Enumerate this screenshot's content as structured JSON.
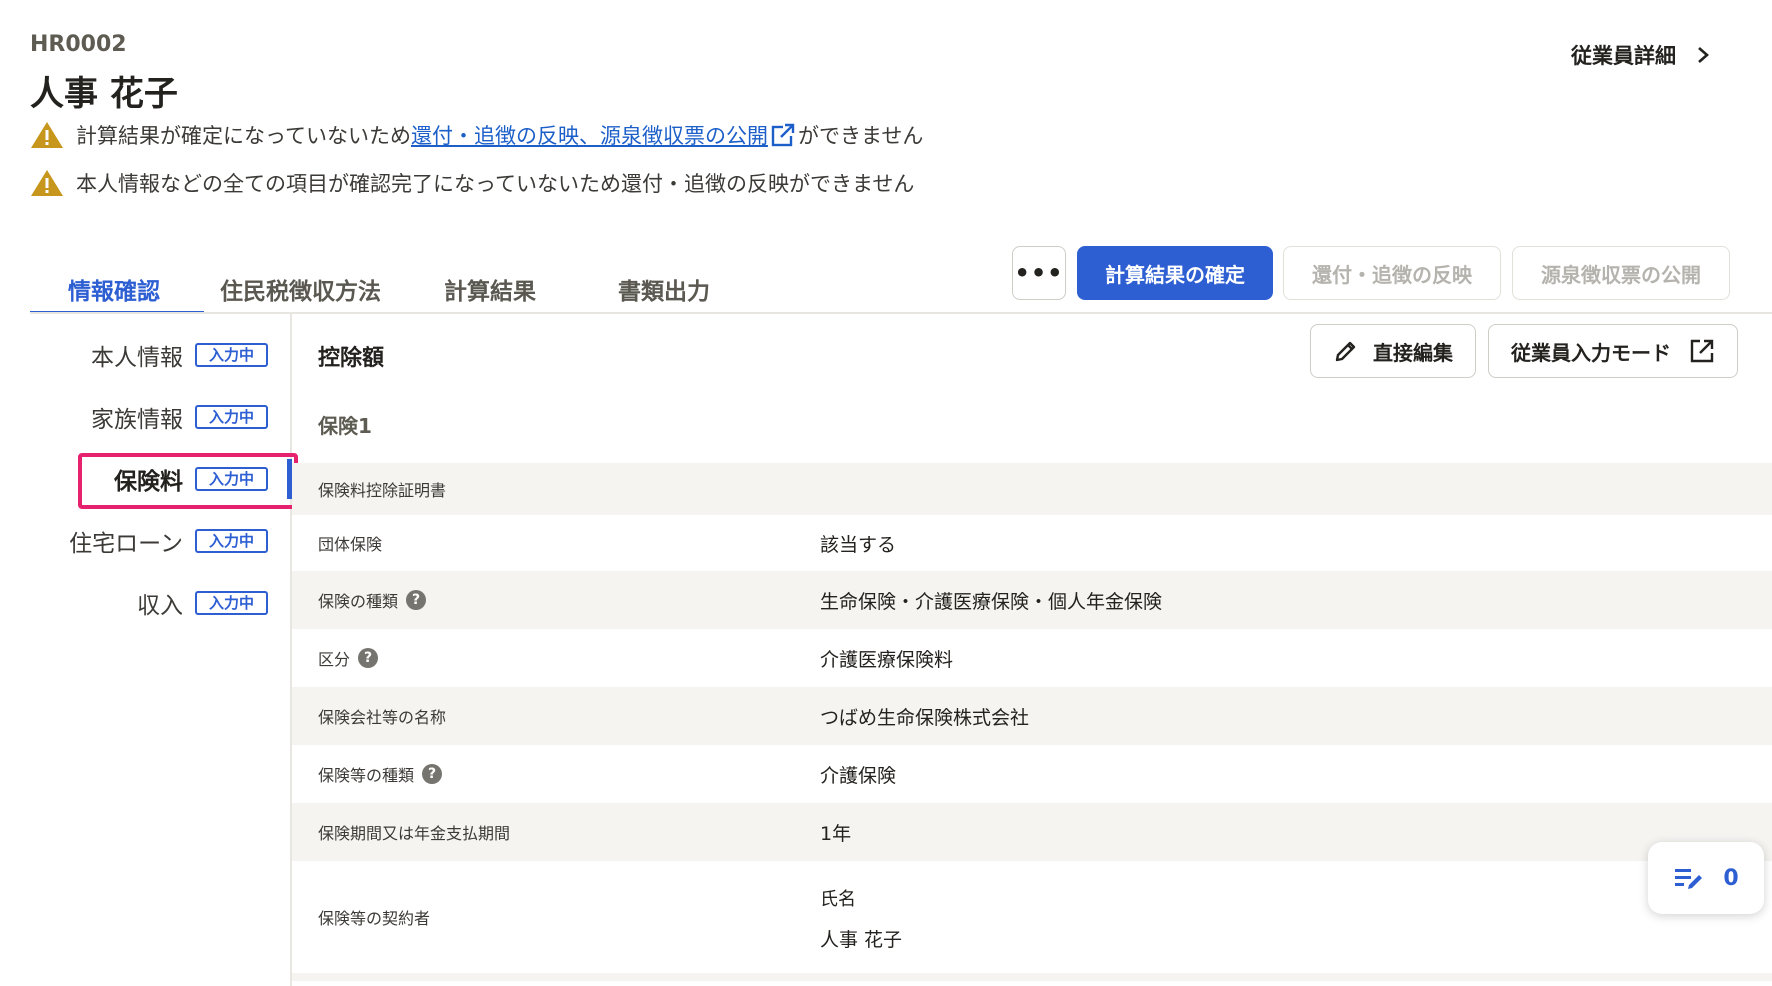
{
  "employee": {
    "id": "HR0002",
    "name": "人事 花子",
    "detail_link": "従業員詳細"
  },
  "warnings": [
    {
      "prefix": "計算結果が確定になっていないため",
      "link": "還付・追徴の反映、源泉徴収票の公開",
      "suffix": "ができません"
    },
    {
      "text": "本人情報などの全ての項目が確認完了になっていないため還付・追徴の反映ができません"
    }
  ],
  "tabs": [
    {
      "label": "情報確認",
      "active": true
    },
    {
      "label": "住民税徴収方法"
    },
    {
      "label": "計算結果"
    },
    {
      "label": "書類出力"
    }
  ],
  "actions": {
    "more": "•••",
    "confirm": "計算結果の確定",
    "refund": "還付・追徴の反映",
    "publish": "源泉徴収票の公開"
  },
  "sidebar": [
    {
      "label": "本人情報",
      "badge": "入力中"
    },
    {
      "label": "家族情報",
      "badge": "入力中"
    },
    {
      "label": "保険料",
      "badge": "入力中",
      "active": true
    },
    {
      "label": "住宅ローン",
      "badge": "入力中"
    },
    {
      "label": "収入",
      "badge": "入力中"
    }
  ],
  "main": {
    "title": "控除額",
    "edit_button": "直接編集",
    "employee_mode_button": "従業員入力モード",
    "subhead": "保険1",
    "rows": [
      {
        "label": "保険料控除証明書",
        "value": ""
      },
      {
        "label": "団体保険",
        "value": "該当する"
      },
      {
        "label": "保険の種類",
        "value": "生命保険・介護医療保険・個人年金保険"
      },
      {
        "label": "区分",
        "value": "介護医療保険料"
      },
      {
        "label": "保険会社等の名称",
        "value": "つばめ生命保険株式会社"
      },
      {
        "label": "保険等の種類",
        "value": "介護保険"
      },
      {
        "label": "保険期間又は年金支払期間",
        "value": "1年"
      },
      {
        "label": "保険等の契約者",
        "sub_label": "氏名",
        "value": "人事 花子"
      }
    ]
  },
  "fab": {
    "count": "0"
  },
  "colors": {
    "accent": "#2d5fd3",
    "highlight": "#e6226e",
    "warning": "#c7961c"
  }
}
